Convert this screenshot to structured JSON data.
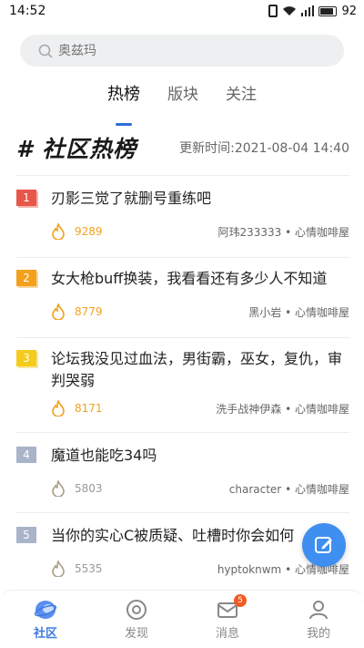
{
  "status": {
    "time": "14:52",
    "battery": "92"
  },
  "search": {
    "placeholder": "奥兹玛"
  },
  "tabs": [
    {
      "label": "热榜",
      "active": true
    },
    {
      "label": "版块",
      "active": false
    },
    {
      "label": "关注",
      "active": false
    }
  ],
  "board": {
    "title": "# 社区热榜",
    "update_label": "更新时间:",
    "update_time": "2021-08-04 14:40"
  },
  "posts": [
    {
      "rank": "1",
      "title": "刃影三觉了就删号重练吧",
      "heat": "9289",
      "author": "阿玮233333",
      "board": "心情咖啡屋"
    },
    {
      "rank": "2",
      "title": "女大枪buff换装，我看看还有多少人不知道",
      "heat": "8779",
      "author": "黑小岩",
      "board": "心情咖啡屋"
    },
    {
      "rank": "3",
      "title": "论坛我没见过血法，男街霸，巫女，复仇，审判哭弱",
      "heat": "8171",
      "author": "洗手战神伊森",
      "board": "心情咖啡屋"
    },
    {
      "rank": "4",
      "title": "魔道也能吃34吗",
      "heat": "5803",
      "author": "character",
      "board": "心情咖啡屋"
    },
    {
      "rank": "5",
      "title": "当你的实心C被质疑、吐槽时你会如何",
      "heat": "5535",
      "author": "hyptoknwm",
      "board": "心情咖啡屋"
    }
  ],
  "separator": "•",
  "nav": [
    {
      "label": "社区",
      "icon": "community-icon",
      "active": true
    },
    {
      "label": "发现",
      "icon": "discover-icon",
      "active": false
    },
    {
      "label": "消息",
      "icon": "message-icon",
      "active": false,
      "badge": "5"
    },
    {
      "label": "我的",
      "icon": "profile-icon",
      "active": false
    }
  ],
  "colors": {
    "accent": "#3f7ae0",
    "hot": "#f3a11c",
    "cold": "#a8a08a"
  }
}
